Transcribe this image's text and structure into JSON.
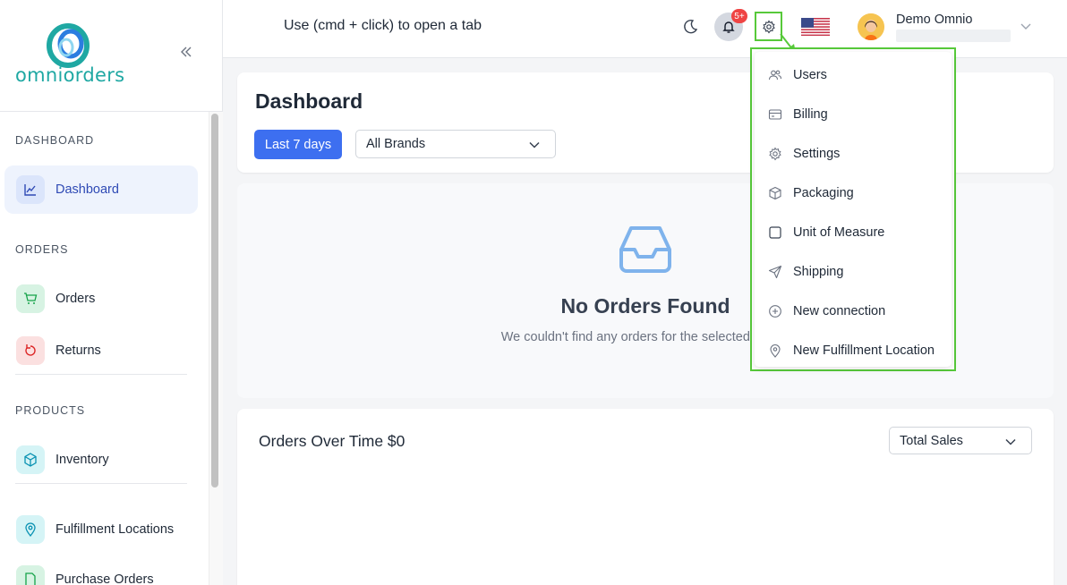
{
  "app": {
    "logo_text": "omniorders"
  },
  "topbar": {
    "hint": "Use (cmd + click) to open a tab",
    "notification_count": "5+",
    "user_name": "Demo Omnio"
  },
  "sidebar": {
    "sections": [
      {
        "label": "DASHBOARD"
      },
      {
        "label": "ORDERS"
      },
      {
        "label": "PRODUCTS"
      }
    ],
    "items": [
      {
        "label": "Dashboard",
        "icon": "chart-line-icon",
        "active": true
      },
      {
        "label": "Orders",
        "icon": "cart-icon"
      },
      {
        "label": "Returns",
        "icon": "return-icon"
      },
      {
        "label": "Inventory",
        "icon": "box-icon"
      },
      {
        "label": "Fulfillment Locations",
        "icon": "location-pin-icon"
      },
      {
        "label": "Purchase Orders",
        "icon": "document-icon"
      }
    ]
  },
  "dashboard": {
    "title": "Dashboard",
    "date_range_button": "Last 7 days",
    "brand_select": "All Brands",
    "empty_title": "No Orders Found",
    "empty_subtitle": "We couldn't find any orders for the selected period"
  },
  "orders_chart": {
    "title": "Orders Over Time $0",
    "metric_select": "Total Sales"
  },
  "settings_menu": {
    "items": [
      {
        "label": "Users",
        "icon": "users-icon"
      },
      {
        "label": "Billing",
        "icon": "credit-card-icon"
      },
      {
        "label": "Settings",
        "icon": "gear-icon"
      },
      {
        "label": "Packaging",
        "icon": "package-icon"
      },
      {
        "label": "Unit of Measure",
        "icon": "square-icon"
      },
      {
        "label": "Shipping",
        "icon": "paper-plane-icon"
      },
      {
        "label": "New connection",
        "icon": "plus-circle-icon"
      },
      {
        "label": "New Fulfillment Location",
        "icon": "map-pin-icon"
      }
    ]
  },
  "colors": {
    "accent": "#3d6ff0",
    "brand": "#1fa8a3",
    "highlight": "#57c93a",
    "badge": "#ef4444"
  }
}
